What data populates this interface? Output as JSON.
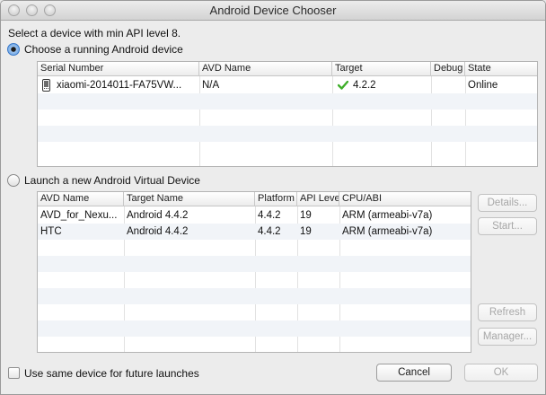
{
  "window": {
    "title": "Android Device Chooser"
  },
  "header": {
    "instruction": "Select a device with min API level 8."
  },
  "running": {
    "radio_label": "Choose a running Android device",
    "columns": [
      "Serial Number",
      "AVD Name",
      "Target",
      "Debug",
      "State"
    ],
    "rows": [
      {
        "serial": "xiaomi-2014011-FA75VW...",
        "avd": "N/A",
        "target": "4.2.2",
        "debug": "",
        "state": "Online",
        "device_icon": "phone-icon",
        "target_icon": "check-icon"
      }
    ]
  },
  "launch": {
    "radio_label": "Launch a new Android Virtual Device",
    "columns": [
      "AVD Name",
      "Target Name",
      "Platform",
      "API Leve",
      "CPU/ABI"
    ],
    "rows": [
      {
        "name": "AVD_for_Nexu...",
        "target": "Android 4.4.2",
        "platform": "4.4.2",
        "api": "19",
        "cpu": "ARM (armeabi-v7a)"
      },
      {
        "name": "HTC",
        "target": "Android 4.4.2",
        "platform": "4.4.2",
        "api": "19",
        "cpu": "ARM (armeabi-v7a)"
      }
    ],
    "buttons": {
      "details": "Details...",
      "start": "Start...",
      "refresh": "Refresh",
      "manager": "Manager..."
    }
  },
  "footer": {
    "checkbox_label": "Use same device for future launches",
    "cancel": "Cancel",
    "ok": "OK"
  },
  "colors": {
    "check": "#3fae2a",
    "selected_radio": "#5d9be0"
  }
}
